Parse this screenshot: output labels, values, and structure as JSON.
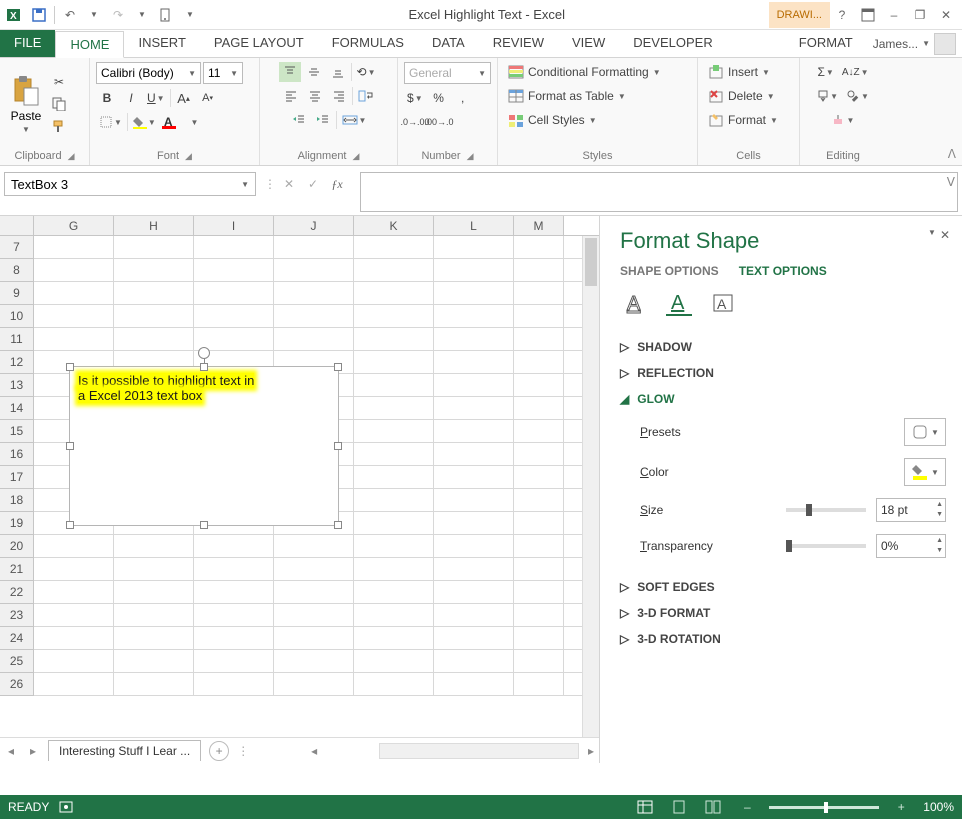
{
  "qat": {
    "save": "save",
    "undo": "undo",
    "redo": "redo",
    "touch": "touch"
  },
  "title": "Excel Highlight Text - Excel",
  "contextual_tab": "DRAWI...",
  "window_btns": {
    "help": "?",
    "ribbonopts": "▭",
    "min": "–",
    "restore": "❐",
    "close": "✕"
  },
  "tabs": [
    "FILE",
    "HOME",
    "INSERT",
    "PAGE LAYOUT",
    "FORMULAS",
    "DATA",
    "REVIEW",
    "VIEW",
    "DEVELOPER"
  ],
  "active_tab": "HOME",
  "context_tab_format": "FORMAT",
  "user_name": "James...",
  "ribbon": {
    "clipboard": {
      "label": "Clipboard",
      "paste": "Paste"
    },
    "font": {
      "label": "Font",
      "font_name": "Calibri (Body)",
      "font_size": "11"
    },
    "alignment": {
      "label": "Alignment"
    },
    "number": {
      "label": "Number",
      "format": "General"
    },
    "styles": {
      "label": "Styles",
      "cond": "Conditional Formatting",
      "table": "Format as Table",
      "cells": "Cell Styles"
    },
    "cells": {
      "label": "Cells",
      "insert": "Insert",
      "delete": "Delete",
      "format": "Format"
    },
    "editing": {
      "label": "Editing"
    }
  },
  "namebox": "TextBox 3",
  "columns": [
    "G",
    "H",
    "I",
    "J",
    "K",
    "L",
    "M"
  ],
  "rows_start": 7,
  "rows_end": 26,
  "textbox": {
    "line1": "Is it possible to highlight text in",
    "line2": "a Excel 2013 text box"
  },
  "sheet_tab": "Interesting Stuff I Lear ...",
  "format_pane": {
    "title": "Format Shape",
    "tabs": {
      "shape": "SHAPE OPTIONS",
      "text": "TEXT OPTIONS"
    },
    "sections": {
      "shadow": "SHADOW",
      "reflection": "REFLECTION",
      "glow": "GLOW",
      "presets": "Presets",
      "color": "Color",
      "size_label": "Size",
      "size_val": "18 pt",
      "transp_label": "Transparency",
      "transp_val": "0%",
      "soft": "SOFT EDGES",
      "threedfmt": "3-D FORMAT",
      "threedrot": "3-D ROTATION"
    }
  },
  "status": {
    "ready": "READY",
    "zoom": "100%"
  }
}
